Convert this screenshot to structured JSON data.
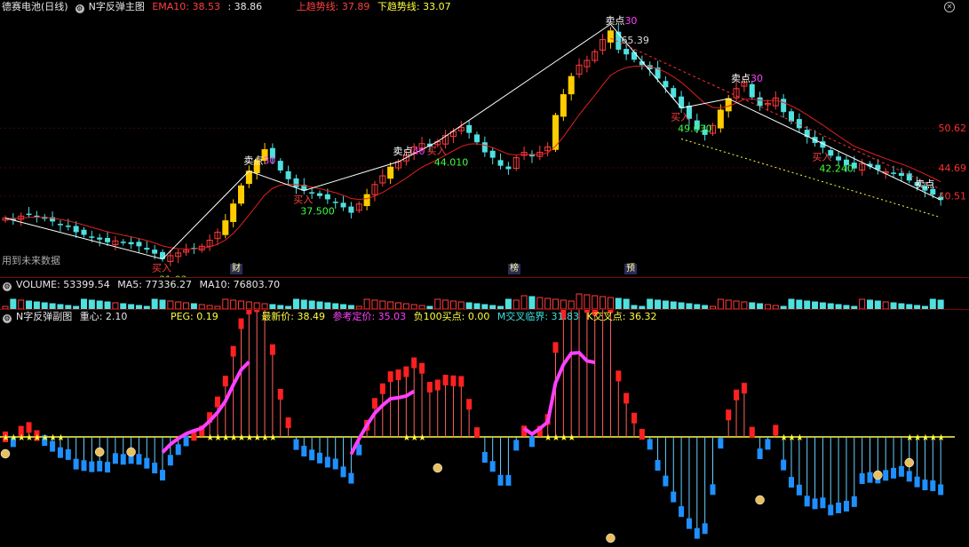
{
  "main": {
    "title": "德赛电池(日线)",
    "indicator": "N字反弹主图",
    "ema_label": "EMA10: 38.53",
    "val2": ": 38.86",
    "upper_trend": "上趋势线: 37.89",
    "lower_trend": "下趋势线: 33.07",
    "future_label": "用到未来数据",
    "price_ticks": [
      "50.62",
      "44.69",
      "40.51"
    ],
    "events": [
      {
        "text": "财"
      },
      {
        "text": "榜"
      },
      {
        "text": "预"
      }
    ],
    "annotations": {
      "sell": [
        "卖点",
        "卖点",
        "卖点",
        "卖点",
        "卖点"
      ],
      "sell_vals": [
        "30",
        "40",
        "30",
        "30"
      ],
      "buy": [
        "买入",
        "买入",
        "买入",
        "买入",
        "买入"
      ],
      "lows": [
        "31.03",
        "37.500",
        "44.010",
        "49.030",
        "42.240"
      ],
      "high": "65.39"
    }
  },
  "volume": {
    "label": "VOLUME: 53399.54",
    "ma5": "MA5: 77336.27",
    "ma10": "MA10: 76803.70"
  },
  "sub": {
    "title": "N字反弹副图",
    "center": "重心: 2.10",
    "peg": "PEG: 0.19",
    "latest": "最新价: 38.49",
    "ref": "参考定价: 35.03",
    "neg100": "负100买点: 0.00",
    "mcross": "M交叉临界: 31.83",
    "kcross": "K交叉点: 36.32"
  },
  "colors": {
    "up": "#ff3b3b",
    "down": "#4fe0e0",
    "ema": "#e02020",
    "white": "#ffffff",
    "yellow": "#ffff40",
    "magenta": "#ff40ff",
    "cyan": "#40ffff",
    "blue": "#1e90ff",
    "red": "#ff2020",
    "sub_bar_pos": "#ff2020",
    "sub_bar_neg": "#1e90ff"
  },
  "chart_data": {
    "type": "candlestick",
    "price_range": [
      30,
      66
    ],
    "days": 120,
    "close": [
      37.2,
      36.9,
      37.5,
      37.8,
      37.4,
      37.1,
      36.7,
      36.2,
      35.9,
      35.1,
      34.7,
      34.3,
      34.0,
      33.6,
      33.8,
      33.5,
      33.3,
      33.0,
      32.5,
      31.9,
      31.1,
      31.6,
      32.0,
      32.4,
      32.7,
      33.0,
      33.9,
      35.1,
      36.8,
      39.3,
      42.0,
      44.2,
      45.8,
      47.4,
      46.1,
      44.3,
      43.0,
      41.8,
      41.3,
      40.9,
      40.5,
      40.0,
      39.6,
      38.8,
      38.0,
      39.3,
      40.7,
      42.2,
      43.5,
      44.8,
      45.6,
      46.5,
      47.8,
      48.3,
      47.9,
      48.6,
      49.5,
      50.1,
      50.7,
      49.9,
      48.5,
      47.0,
      46.2,
      45.0,
      44.5,
      46.2,
      47.0,
      46.4,
      47.0,
      47.8,
      52.5,
      55.6,
      58.3,
      60.0,
      60.7,
      62.0,
      63.8,
      65.1,
      62.3,
      61.6,
      60.8,
      60.0,
      59.4,
      58.0,
      56.7,
      55.2,
      53.6,
      52.0,
      50.4,
      49.6,
      51.0,
      53.3,
      55.0,
      56.5,
      57.4,
      55.2,
      53.9,
      54.3,
      55.1,
      53.0,
      51.6,
      50.6,
      49.3,
      48.4,
      47.7,
      46.5,
      45.8,
      45.1,
      44.6,
      45.3,
      44.9,
      44.4,
      44.1,
      43.8,
      43.5,
      42.8,
      42.0,
      41.3,
      40.7,
      39.9
    ]
  }
}
